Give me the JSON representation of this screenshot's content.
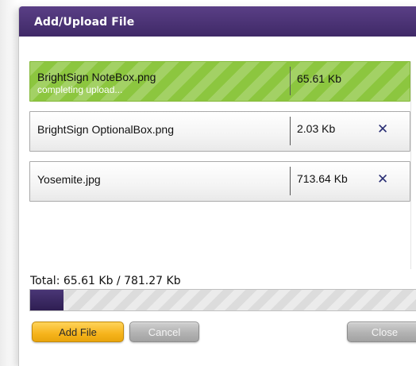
{
  "dialog": {
    "title": "Add/Upload File"
  },
  "files": [
    {
      "name": "BrightSign NoteBox.png",
      "status": "completing upload...",
      "size": "65.61 Kb",
      "uploading": true
    },
    {
      "name": "BrightSign OptionalBox.png",
      "status": "",
      "size": "2.03 Kb",
      "remove_icon": "close-icon",
      "remove_glyph": "✕"
    },
    {
      "name": "Yosemite.jpg",
      "status": "",
      "size": "713.64 Kb",
      "remove_icon": "close-icon",
      "remove_glyph": "✕"
    }
  ],
  "total": {
    "label": "Total: 65.61 Kb / 781.27 Kb",
    "progress_fraction": 0.084
  },
  "buttons": {
    "add_file": "Add File",
    "cancel": "Cancel",
    "close": "Close"
  },
  "colors": {
    "titlebar": "#4a3276",
    "upload_row": "#8cc63f",
    "progress_fill": "#3a2a62",
    "add_button": "#f6b41c",
    "remove_icon": "#2a2f74"
  }
}
